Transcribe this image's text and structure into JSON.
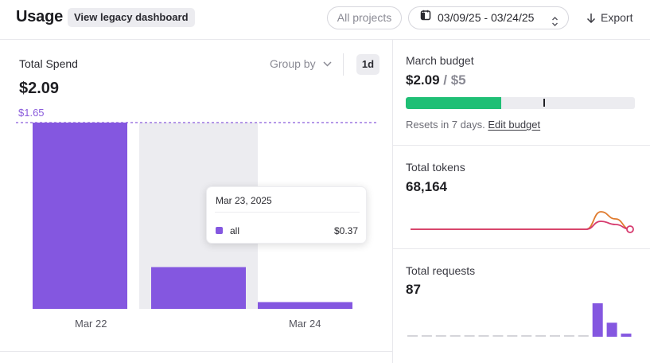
{
  "header": {
    "title": "Usage",
    "legacy_button": "View legacy dashboard",
    "projects_button": "All projects",
    "date_range": "03/09/25 - 03/24/25",
    "export_button": "Export"
  },
  "spend_panel": {
    "label": "Total Spend",
    "value": "$2.09",
    "group_by": "Group by",
    "interval": "1d",
    "max_line_label": "$1.65"
  },
  "tooltip": {
    "date": "Mar 23, 2025",
    "series": "all",
    "value": "$0.37"
  },
  "chart_data": {
    "type": "bar",
    "categories": [
      "Mar 22",
      "Mar 23",
      "Mar 24"
    ],
    "x_tick_labels": [
      "Mar 22",
      "Mar 24"
    ],
    "series": [
      {
        "name": "all",
        "values": [
          1.65,
          0.37,
          0.06
        ]
      }
    ],
    "reference_line": 1.65,
    "ylim": [
      0,
      1.65
    ],
    "highlighted_category": "Mar 23",
    "colors": {
      "bar": "#8457e0",
      "highlight_bg": "#ececf0",
      "reference_line": "#8a5cdc"
    }
  },
  "budget": {
    "label": "March budget",
    "spent": "$2.09",
    "separator": " / ",
    "limit": "$5",
    "used_fraction": 0.418,
    "resets_text": "Resets in 7 days.",
    "edit_link": "Edit budget",
    "colors": {
      "fill": "#1fbf75"
    }
  },
  "tokens": {
    "label": "Total tokens",
    "value": "68,164",
    "sparkline": {
      "type": "line",
      "series": [
        {
          "values": [
            0,
            0,
            0,
            0,
            0,
            0,
            0,
            0,
            0,
            0,
            0,
            0,
            0,
            22,
            13,
            0
          ],
          "color": "#e07b2e"
        },
        {
          "values": [
            0,
            0,
            0,
            0,
            0,
            0,
            0,
            0,
            0,
            0,
            0,
            0,
            0,
            10,
            6,
            0
          ],
          "color": "#d63a6e"
        }
      ]
    }
  },
  "requests": {
    "label": "Total requests",
    "value": "87",
    "sparkline": {
      "type": "bar",
      "values": [
        0,
        0,
        0,
        0,
        0,
        0,
        0,
        0,
        0,
        0,
        0,
        0,
        0,
        43,
        18,
        4
      ],
      "color": "#8457e0",
      "empty_color": "#d5d5da"
    }
  }
}
